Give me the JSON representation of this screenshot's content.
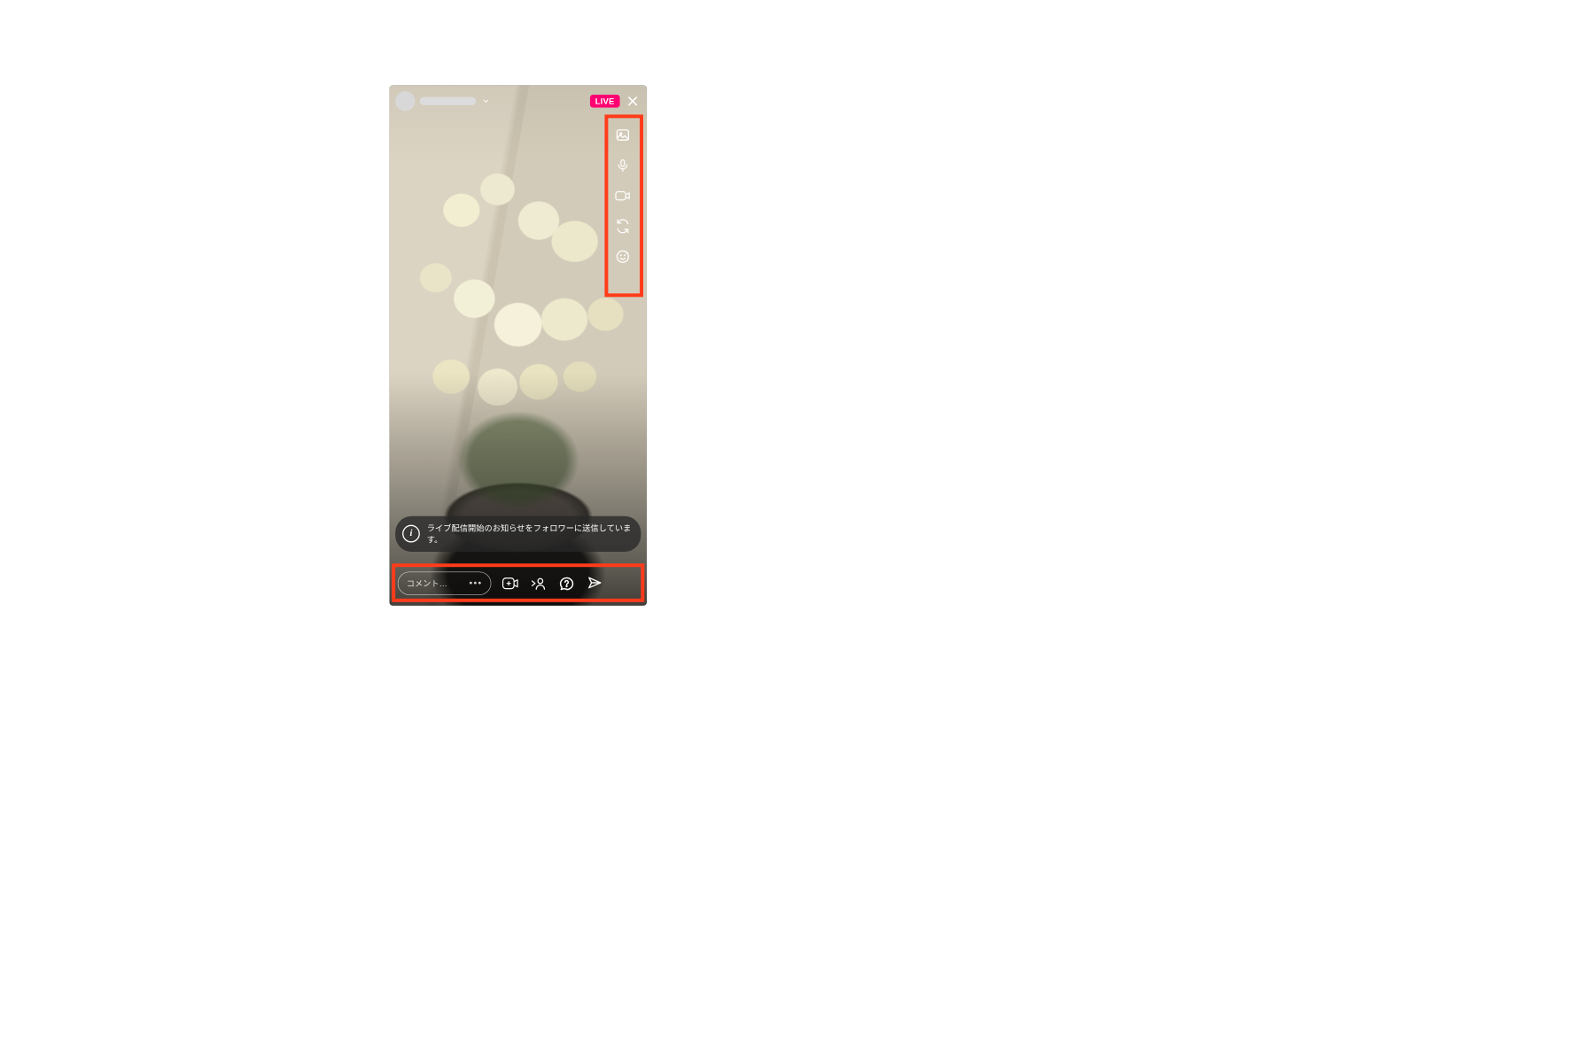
{
  "header": {
    "username_placeholder": "",
    "live_label": "LIVE",
    "chevron_icon": "chevron-down-icon",
    "close_icon": "close-icon"
  },
  "side_tools": {
    "items": [
      {
        "name": "gallery-icon"
      },
      {
        "name": "microphone-icon"
      },
      {
        "name": "video-camera-icon"
      },
      {
        "name": "switch-camera-icon"
      },
      {
        "name": "face-effects-icon"
      }
    ]
  },
  "info_banner": {
    "icon": "info-icon",
    "text": "ライブ配信開始のお知らせをフォロワーに送信しています。"
  },
  "bottom_bar": {
    "comment_placeholder": "コメント…",
    "more_icon": "more-options-icon",
    "items": [
      {
        "name": "add-guest-icon"
      },
      {
        "name": "invite-person-icon"
      },
      {
        "name": "questions-icon"
      },
      {
        "name": "send-icon"
      }
    ]
  },
  "annotations": {
    "highlight_color": "#ff3b1a",
    "boxes": [
      "side-tools",
      "bottom-bar"
    ]
  }
}
